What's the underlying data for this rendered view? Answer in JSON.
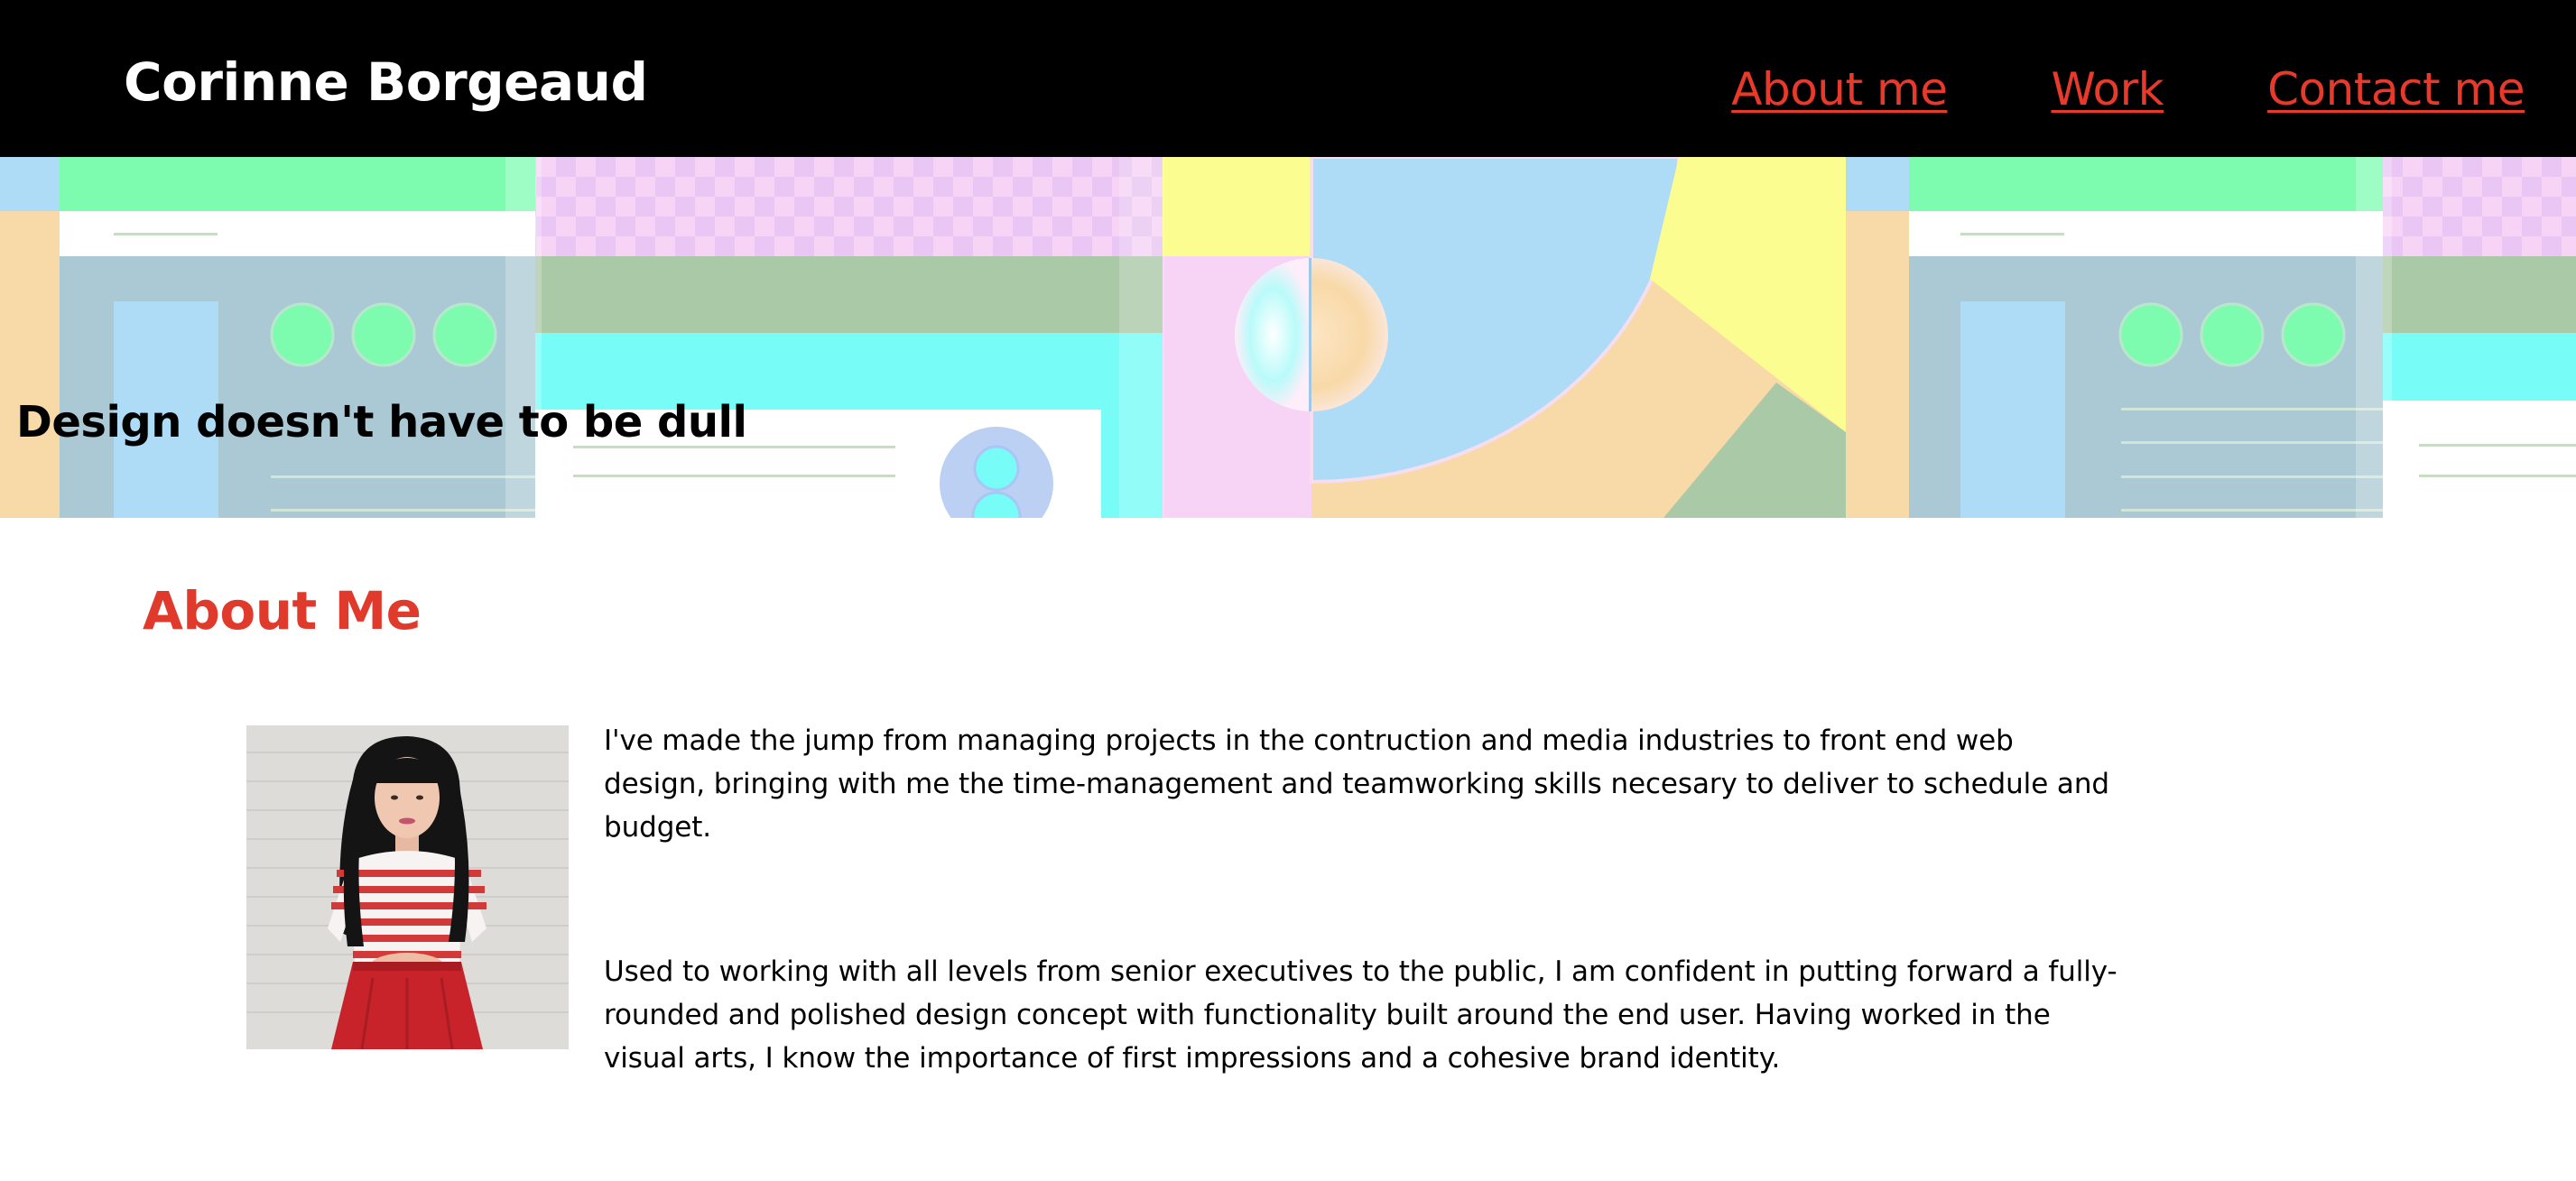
{
  "header": {
    "site_title": "Corinne Borgeaud",
    "nav": [
      {
        "label": "About me"
      },
      {
        "label": "Work"
      },
      {
        "label": "Contact me"
      }
    ],
    "link_color": "#e8392a"
  },
  "hero": {
    "tagline": "Design doesn't have to be dull",
    "palette": [
      "#7dfcb0",
      "#f7d4f5",
      "#fbfd91",
      "#aedbf6",
      "#f8d9a8",
      "#aac9a7",
      "#77fcf7",
      "#bcd0f4"
    ]
  },
  "about": {
    "heading": "About Me",
    "heading_color": "#e03a2c",
    "paragraphs": [
      "I've made the jump from managing projects in the contruction and media industries to front end web design, bringing with me the time-management and teamworking skills necesary to deliver to schedule and budget.",
      "Used to working with all levels from senior executives to the public, I am confident in putting forward a fully-rounded and polished design concept with functionality built around the end user. Having worked in the visual arts, I know the importance of first impressions and a cohesive brand identity."
    ]
  }
}
